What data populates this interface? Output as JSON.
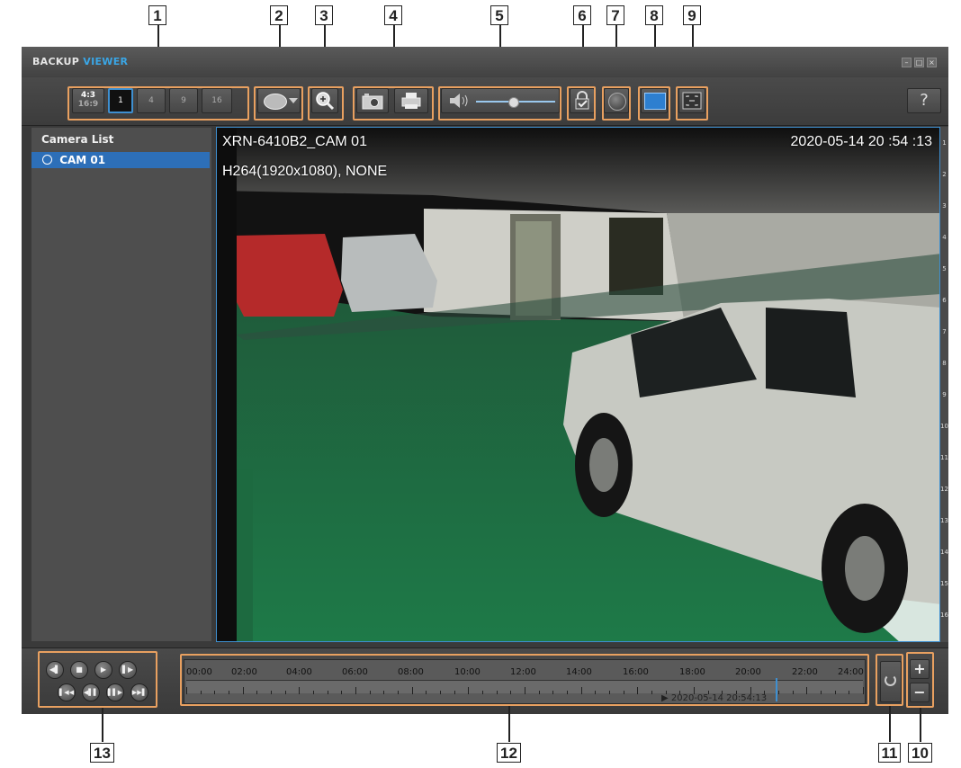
{
  "callouts": {
    "c1": "1",
    "c2": "2",
    "c3": "3",
    "c4": "4",
    "c5": "5",
    "c6": "6",
    "c7": "7",
    "c8": "8",
    "c9": "9",
    "c10": "10",
    "c11": "11",
    "c12": "12",
    "c13": "13"
  },
  "window": {
    "title_main": "BACKUP",
    "title_accent": "VIEWER",
    "accent_color": "#3aa6e6"
  },
  "toolbar": {
    "ratio_43": "4:3",
    "ratio_169": "16:9",
    "split_1": "1",
    "split_4": "4",
    "split_9": "9",
    "split_16": "16",
    "help": "?"
  },
  "camera_list": {
    "title": "Camera List",
    "items": [
      {
        "label": "CAM 01",
        "selected": true
      }
    ]
  },
  "video": {
    "camera_name": "XRN-6410B2_CAM 01",
    "timestamp": "2020-05-14 20 :54 :13",
    "codec_info": "H264(1920x1080), NONE"
  },
  "channel_ruler": [
    "1",
    "2",
    "3",
    "4",
    "5",
    "6",
    "7",
    "8",
    "9",
    "10",
    "11",
    "12",
    "13",
    "14",
    "15",
    "16"
  ],
  "timeline": {
    "hours": [
      "00:00",
      "02:00",
      "04:00",
      "06:00",
      "08:00",
      "10:00",
      "12:00",
      "14:00",
      "16:00",
      "18:00",
      "20:00",
      "22:00",
      "24:00"
    ],
    "current": "▶ 2020-05-14 20:54:13",
    "selection_color": "#3e8fd0"
  },
  "playback": {
    "row1": [
      "◀▌",
      "■",
      "▶",
      "▌▶"
    ],
    "row2": [
      "▌◀◀",
      "◀▌▌",
      "▌▌▶",
      "▶▶▌"
    ]
  },
  "zoom": {
    "plus": "+",
    "minus": "−"
  }
}
